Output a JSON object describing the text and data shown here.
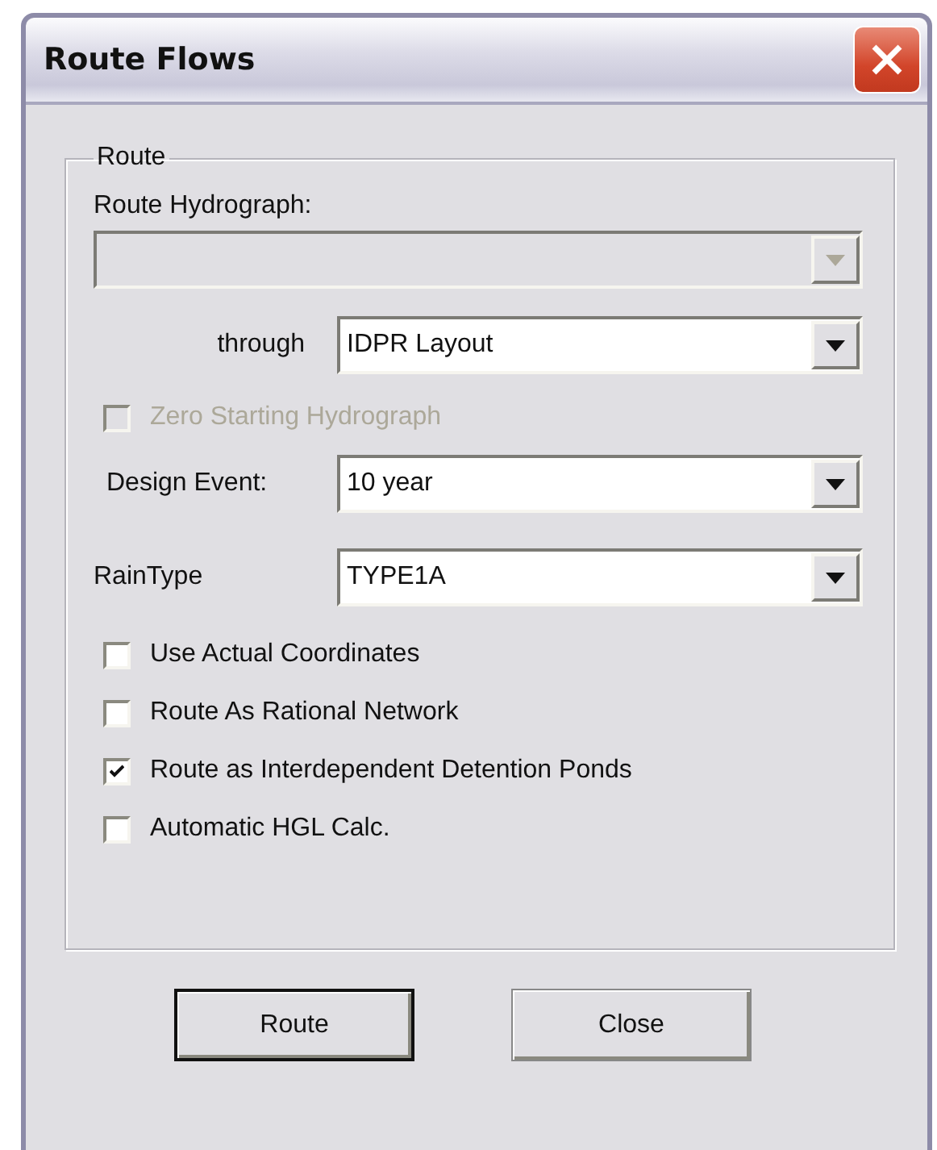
{
  "window": {
    "title": "Route Flows"
  },
  "group": {
    "title": "Route",
    "hydrograph": {
      "label": "Route Hydrograph:",
      "disabled": true
    },
    "through": {
      "label": "through",
      "value": "IDPR Layout",
      "disabled": false
    },
    "zero_starting": {
      "label": "Zero Starting Hydrograph",
      "checked": false,
      "disabled": true
    },
    "design_event": {
      "label": "Design Event:",
      "value": "10 year",
      "disabled": false
    },
    "rain_type": {
      "label": "RainType",
      "value": "TYPE1A",
      "disabled": false
    },
    "options": [
      {
        "label": "Use Actual Coordinates",
        "checked": false,
        "disabled": false
      },
      {
        "label": "Route As Rational Network",
        "checked": false,
        "disabled": false
      },
      {
        "label": "Route as Interdependent Detention Ponds",
        "checked": true,
        "disabled": false
      },
      {
        "label": "Automatic HGL Calc.",
        "checked": false,
        "disabled": false
      }
    ]
  },
  "buttons": [
    {
      "label": "Route",
      "default": true
    },
    {
      "label": "Close",
      "default": false
    }
  ]
}
